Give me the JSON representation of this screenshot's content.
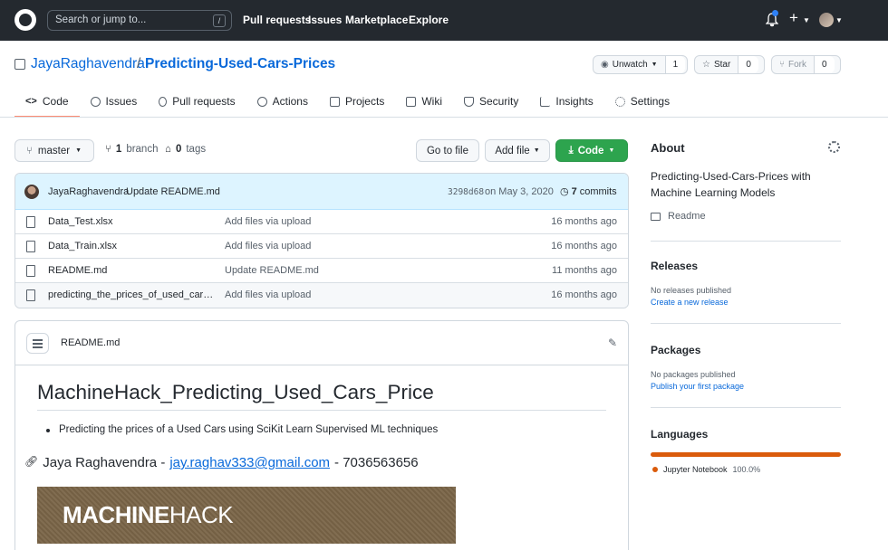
{
  "header": {
    "search_placeholder": "Search or jump to...",
    "search_shortcut": "/",
    "nav": [
      "Pull requests",
      "Issues",
      "Marketplace",
      "Explore"
    ],
    "plus": "+"
  },
  "repo": {
    "owner": "JayaRaghavendra",
    "separator": "/",
    "name": "Predicting-Used-Cars-Prices",
    "watch_label": "Unwatch",
    "watch_count": "1",
    "star_label": "Star",
    "star_count": "0",
    "fork_label": "Fork",
    "fork_count": "0"
  },
  "tabs": [
    {
      "label": "Code",
      "icon": "<>"
    },
    {
      "label": "Issues"
    },
    {
      "label": "Pull requests"
    },
    {
      "label": "Actions"
    },
    {
      "label": "Projects"
    },
    {
      "label": "Wiki"
    },
    {
      "label": "Security"
    },
    {
      "label": "Insights"
    },
    {
      "label": "Settings"
    }
  ],
  "toolbar": {
    "branch": "master",
    "branches_count": "1",
    "branches_label": "branch",
    "tags_count": "0",
    "tags_label": "tags",
    "go_to_file": "Go to file",
    "add_file": "Add file",
    "code": "Code"
  },
  "commit": {
    "author": "JayaRaghavendra",
    "message": "Update README.md",
    "sha": "3298d68",
    "date": "on May 3, 2020",
    "commits_count": "7",
    "commits_label": "commits"
  },
  "files": [
    {
      "name": "Data_Test.xlsx",
      "message": "Add files via upload",
      "age": "16 months ago"
    },
    {
      "name": "Data_Train.xlsx",
      "message": "Add files via upload",
      "age": "16 months ago"
    },
    {
      "name": "README.md",
      "message": "Update README.md",
      "age": "11 months ago"
    },
    {
      "name": "predicting_the_prices_of_used_cars.ip...",
      "message": "Add files via upload",
      "age": "16 months ago"
    }
  ],
  "readme": {
    "file_title": "README.md",
    "h1": "MachineHack_Predicting_Used_Cars_Price",
    "bullet": "Predicting the prices of a Used Cars using SciKit Learn Supervised ML techniques",
    "author_prefix": "Jaya Raghavendra -",
    "email": "jay.raghav333@gmail.com",
    "phone": "- 7036563656",
    "banner_bold": "MACHINE",
    "banner_thin": "HACK"
  },
  "sidebar": {
    "about_title": "About",
    "about_desc": "Predicting-Used-Cars-Prices with Machine Learning Models",
    "readme_label": "Readme",
    "releases_title": "Releases",
    "releases_empty": "No releases published",
    "releases_link": "Create a new release",
    "packages_title": "Packages",
    "packages_empty": "No packages published",
    "packages_link": "Publish your first package",
    "languages_title": "Languages",
    "language_name": "Jupyter Notebook",
    "language_pct": "100.0%",
    "language_color": "#da5b0b"
  }
}
